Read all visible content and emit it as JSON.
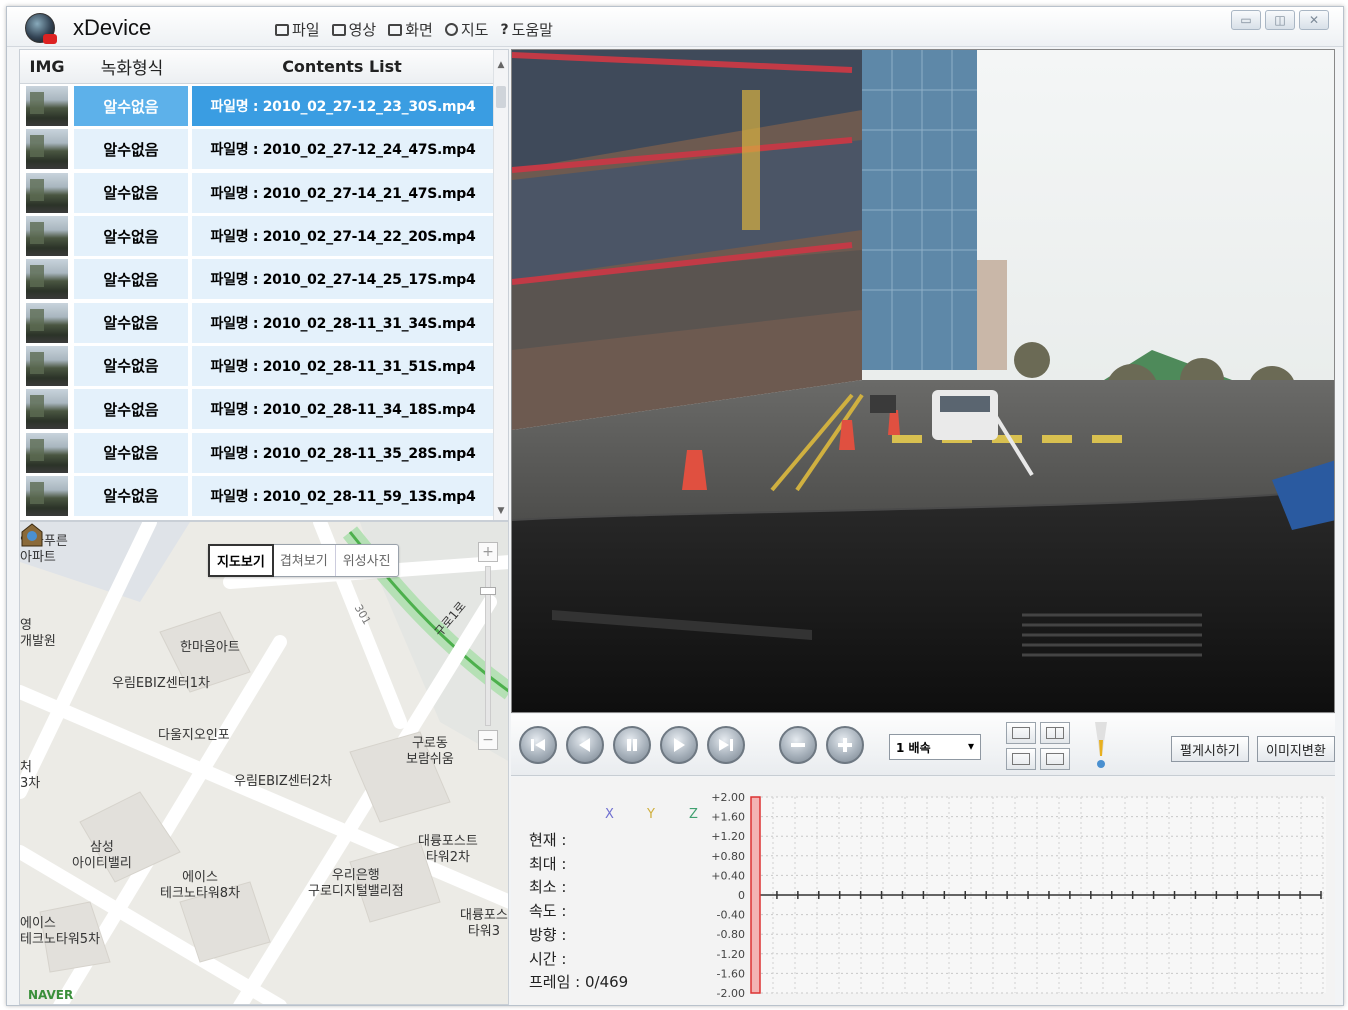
{
  "app": {
    "title": "xDevice",
    "menu": [
      {
        "label": "파일",
        "icon": "save-icon"
      },
      {
        "label": "영상",
        "icon": "video-icon"
      },
      {
        "label": "화면",
        "icon": "monitor-icon"
      },
      {
        "label": "지도",
        "icon": "map-pin-icon"
      },
      {
        "label": "도움말",
        "icon": "help-icon"
      }
    ]
  },
  "content_list": {
    "headers": {
      "img": "IMG",
      "format": "녹화형식",
      "list": "Contents List"
    },
    "selected_index": 0,
    "rows": [
      {
        "format": "알수없음",
        "name": "파일명 : 2010_02_27-12_23_30S.mp4"
      },
      {
        "format": "알수없음",
        "name": "파일명 : 2010_02_27-12_24_47S.mp4"
      },
      {
        "format": "알수없음",
        "name": "파일명 : 2010_02_27-14_21_47S.mp4"
      },
      {
        "format": "알수없음",
        "name": "파일명 : 2010_02_27-14_22_20S.mp4"
      },
      {
        "format": "알수없음",
        "name": "파일명 : 2010_02_27-14_25_17S.mp4"
      },
      {
        "format": "알수없음",
        "name": "파일명 : 2010_02_28-11_31_34S.mp4"
      },
      {
        "format": "알수없음",
        "name": "파일명 : 2010_02_28-11_31_51S.mp4"
      },
      {
        "format": "알수없음",
        "name": "파일명 : 2010_02_28-11_34_18S.mp4"
      },
      {
        "format": "알수없음",
        "name": "파일명 : 2010_02_28-11_35_28S.mp4"
      },
      {
        "format": "알수없음",
        "name": "파일명 : 2010_02_28-11_59_13S.mp4"
      }
    ]
  },
  "map": {
    "tabs": [
      "지도보기",
      "겹쳐보기",
      "위성사진"
    ],
    "active_tab": 0,
    "labels": {
      "l1": "인늘푸른\n아파트",
      "l2": "영\n개발원",
      "l3": "한마음아트",
      "l4": "우림EBIZ센터1차",
      "l5": "다울지오인포",
      "l6": "구로동\n보람쉬움",
      "l7": "우림EBIZ센터2차",
      "l8": "처\n3차",
      "l9": "삼성\n아이티밸리",
      "l10": "에이스\n테크노타워8차",
      "l11": "우리은행\n구로디지털밸리점",
      "l12": "대륭포스트\n타워2차",
      "l13": "에이스\n테크노타워5차",
      "l14": "대륭포스\n타워3",
      "road1": "구로1로",
      "road2": "301"
    },
    "provider": "NAVER"
  },
  "controls": {
    "buttons": [
      "first-icon",
      "prev-icon",
      "pause-icon",
      "play-icon",
      "last-icon",
      "zoom-out-icon",
      "zoom-in-icon"
    ],
    "speed": "1 배속",
    "show_all_label": "펼게시하기",
    "image_convert_label": "이미지변환"
  },
  "sensor": {
    "axes": [
      "X",
      "Y",
      "Z"
    ],
    "axis_colors": [
      "#7070d0",
      "#d0b040",
      "#40a070"
    ],
    "stats": [
      {
        "label": "현재",
        "value": ""
      },
      {
        "label": "최대",
        "value": ""
      },
      {
        "label": "최소",
        "value": ""
      },
      {
        "label": "속도",
        "value": ""
      },
      {
        "label": "방향",
        "value": ""
      },
      {
        "label": "시간",
        "value": ""
      }
    ],
    "frame": "프레임 : 0/469"
  },
  "chart_data": {
    "type": "line",
    "title": "",
    "xlabel": "",
    "ylabel": "",
    "ylim": [
      -2.0,
      2.0
    ],
    "y_ticks": [
      "+2.00",
      "+1.60",
      "+1.20",
      "+0.80",
      "+0.40",
      "0",
      "-0.40",
      "-0.80",
      "-1.20",
      "-1.60",
      "-2.00"
    ],
    "grid": true,
    "series": [
      {
        "values": [
          0,
          0,
          0,
          0,
          0,
          0,
          0,
          0,
          0,
          0,
          0,
          0,
          0,
          0,
          0,
          0,
          0,
          0,
          0,
          0,
          0,
          0,
          0,
          0,
          0,
          0,
          0,
          0
        ]
      }
    ],
    "current_frame": 0,
    "total_frames": 469
  }
}
